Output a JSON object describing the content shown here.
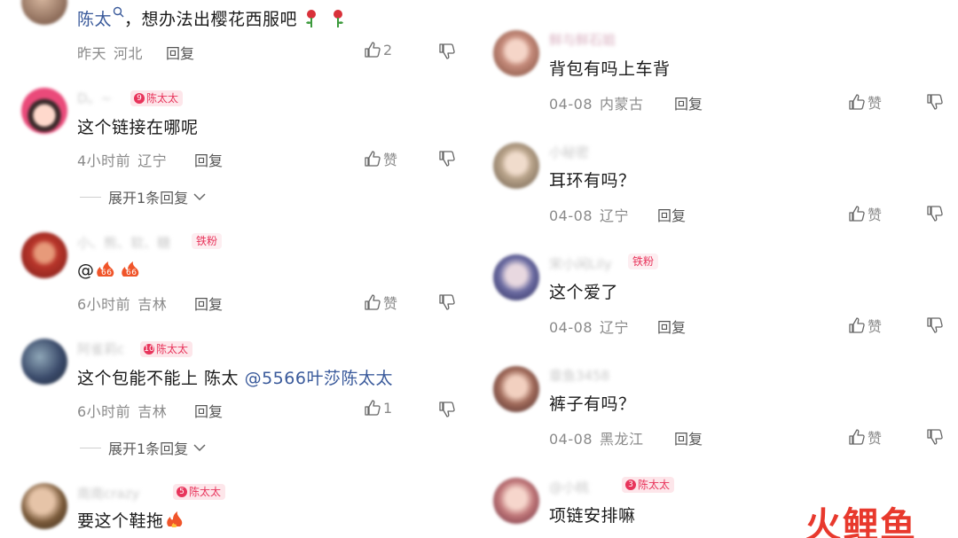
{
  "colors": {
    "badge_bg": "#fde6ea",
    "badge_text": "#e8345b",
    "mention": "#3a5a9b",
    "meta": "#8a8a8a",
    "watermark": "#e8392d"
  },
  "left": {
    "c0": {
      "text_mention": "陈太",
      "text_rest": "，想办法出樱花西服吧",
      "date": "昨天",
      "location": "河北",
      "reply": "回复",
      "likes": "2"
    },
    "c1": {
      "username": "D。~",
      "badge_level": "9",
      "badge": "陈太太",
      "text": "这个链接在哪呢",
      "date": "4小时前",
      "location": "辽宁",
      "reply": "回复",
      "likes": "赞",
      "expand": "展开1条回复"
    },
    "c2": {
      "username": "小、熊、软、糖",
      "badge": "铁粉",
      "text": "@",
      "date": "6小时前",
      "location": "吉林",
      "reply": "回复",
      "likes": "赞"
    },
    "c3": {
      "username": "阿雀莉c",
      "badge_level": "10",
      "badge": "陈太太",
      "text": "这个包能不能上 陈太",
      "mention": "@5566叶莎陈太太",
      "date": "6小时前",
      "location": "吉林",
      "reply": "回复",
      "likes": "1",
      "expand": "展开1条回复"
    },
    "c4": {
      "username": "南南crazy",
      "badge_level": "5",
      "badge": "陈太太",
      "text": "要这个鞋拖"
    }
  },
  "right": {
    "c0": {
      "username": "鲜与鲜石姐",
      "text": "背包有吗上车背",
      "date": "04-08",
      "location": "内蒙古",
      "reply": "回复",
      "likes": "赞"
    },
    "c1": {
      "username": "小秘密",
      "text": "耳环有吗？",
      "date": "04-08",
      "location": "辽宁",
      "reply": "回复",
      "likes": "赞"
    },
    "c2": {
      "username": "宋小闲Lily",
      "badge": "铁粉",
      "text": "这个爱了",
      "date": "04-08",
      "location": "辽宁",
      "reply": "回复",
      "likes": "赞"
    },
    "c3": {
      "username": "章鱼3458",
      "text": "裤子有吗？",
      "date": "04-08",
      "location": "黑龙江",
      "reply": "回复",
      "likes": "赞"
    },
    "c4": {
      "username": "@小桃",
      "badge_level": "3",
      "badge": "陈太太",
      "text": "项链安排嘛"
    }
  },
  "watermark": {
    "part1": "火",
    "part2": "鲤鱼"
  }
}
